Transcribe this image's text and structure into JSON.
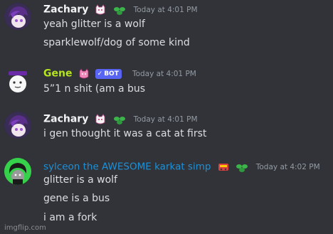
{
  "messages": [
    {
      "username": "Zachary",
      "name_color": "#f2f3f5",
      "timestamp": "Today at 4:01 PM",
      "lines": [
        "yeah glitter is a wolf",
        "sparklewolf/dog of some kind"
      ]
    },
    {
      "username": "Gene",
      "name_color": "#b5e61d",
      "bot_tag": "BOT",
      "timestamp": "Today at 4:01 PM",
      "lines": [
        "5”1 n shit (am a bus"
      ]
    },
    {
      "username": "Zachary",
      "name_color": "#f2f3f5",
      "timestamp": "Today at 4:01 PM",
      "lines": [
        "i gen thought it was a cat at first"
      ]
    },
    {
      "username": "sylceon the AWESOME karkat simp",
      "name_color": "#1e90d6",
      "timestamp": "Today at 4:02 PM",
      "lines": [
        "glitter is a wolf",
        "gene is a bus",
        "i am a fork"
      ]
    }
  ],
  "watermark": "imgflip.com",
  "icons": {
    "badge": "cat-emoji-badge-icon",
    "leaf": "leaf-emoji-icon",
    "bot_check": "checkmark-icon"
  }
}
